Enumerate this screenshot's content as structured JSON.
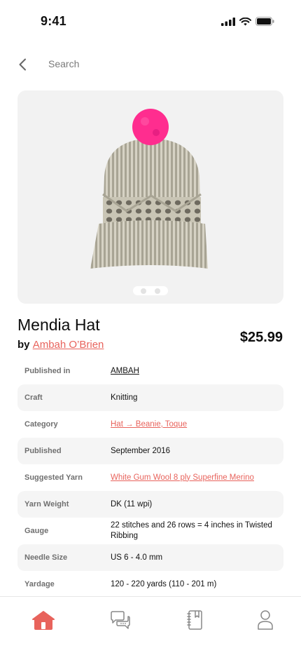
{
  "status_bar": {
    "time": "9:41"
  },
  "nav": {
    "search_label": "Search"
  },
  "product": {
    "title": "Mendia Hat",
    "by_prefix": "by",
    "author": "Ambah O’Brien",
    "price": "$25.99"
  },
  "details": [
    {
      "label": "Published in",
      "value": "AMBAH"
    },
    {
      "label": "Craft",
      "value": "Knitting"
    },
    {
      "label": "Category",
      "value": "Hat → Beanie, Toque"
    },
    {
      "label": "Published",
      "value": "September 2016"
    },
    {
      "label": "Suggested Yarn",
      "value": "White Gum Wool 8 ply Superfine Merino"
    },
    {
      "label": "Yarn Weight",
      "value": "DK (11 wpi)"
    },
    {
      "label": "Gauge",
      "value": "22 stitches and 26 rows = 4 inches in Twisted Ribbing"
    },
    {
      "label": "Needle Size",
      "value": "US 6 - 4.0 mm"
    },
    {
      "label": "Yardage",
      "value": "120 - 220 yards (110 - 201 m)"
    }
  ],
  "gallery": {
    "page_count": 2,
    "active_index": 0
  },
  "tab_bar": {
    "items": [
      {
        "icon": "home-icon",
        "active": true
      },
      {
        "icon": "chat-icon",
        "active": false
      },
      {
        "icon": "notebook-icon",
        "active": false
      },
      {
        "icon": "profile-icon",
        "active": false
      }
    ]
  },
  "colors": {
    "accent": "#e8635c",
    "pompom": "#ff2d8f",
    "hat": "#b9b5a6"
  }
}
